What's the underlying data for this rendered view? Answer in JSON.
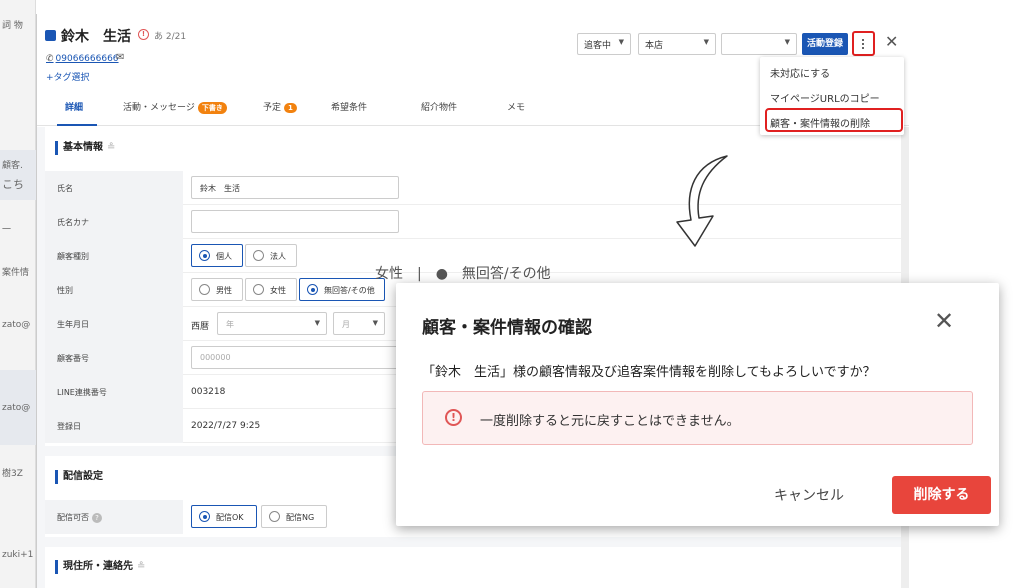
{
  "background_left": {
    "items": [
      "詞 物",
      "顧客.",
      "こち",
      "一",
      "案件情",
      "zato@",
      "zato@",
      "樹3Z",
      "zuki+1"
    ]
  },
  "customer": {
    "name": "鈴木　生活",
    "alert_count": "2/21",
    "phone": "09066666666",
    "tag_select": "+タグ選択"
  },
  "tabs": [
    {
      "label": "詳細"
    },
    {
      "label": "活動・メッセージ",
      "badge": "下書き"
    },
    {
      "label": "予定",
      "badge": "1"
    },
    {
      "label": "希望条件"
    },
    {
      "label": "紹介物件"
    },
    {
      "label": "メモ"
    }
  ],
  "toolbar": {
    "status": "追客中",
    "store": "本店",
    "third": "",
    "activity_button": "活動登録"
  },
  "menu": {
    "items": [
      "未対応にする",
      "マイページURLのコピー",
      "顧客・案件情報の削除"
    ]
  },
  "basic_info": {
    "title": "基本情報",
    "fields": {
      "name_label": "氏名",
      "name_value": "鈴木　生活",
      "kana_label": "氏名カナ",
      "kana_value": "",
      "type_label": "顧客種別",
      "type_options": [
        "個人",
        "法人"
      ],
      "gender_label": "性別",
      "gender_options": [
        "男性",
        "女性",
        "無回答/その他"
      ],
      "birth_label": "生年月日",
      "era": "西暦",
      "year_ph": "年",
      "month_ph": "月",
      "cust_no_label": "顧客番号",
      "cust_no_ph": "000000",
      "line_label": "LINE連携番号",
      "line_value": "003218",
      "reg_label": "登録日",
      "reg_value": "2022/7/27 9:25"
    }
  },
  "delivery": {
    "title": "配信設定",
    "allow_label": "配信可否",
    "options": [
      "配信OK",
      "配信NG"
    ]
  },
  "address": {
    "title": "現住所・連絡先"
  },
  "background_hint": "女性　|　●　無回答/その他",
  "modal": {
    "title": "顧客・案件情報の確認",
    "message": "「鈴木　生活」様の顧客情報及び追客案件情報を削除してもよろしいですか？",
    "warning": "一度削除すると元に戻すことはできません。",
    "cancel": "キャンセル",
    "delete": "削除する"
  },
  "colors": {
    "accent": "#1a56b4",
    "danger": "#e8453c",
    "highlight": "#e02020",
    "warning_bg": "#fdf1f1"
  }
}
